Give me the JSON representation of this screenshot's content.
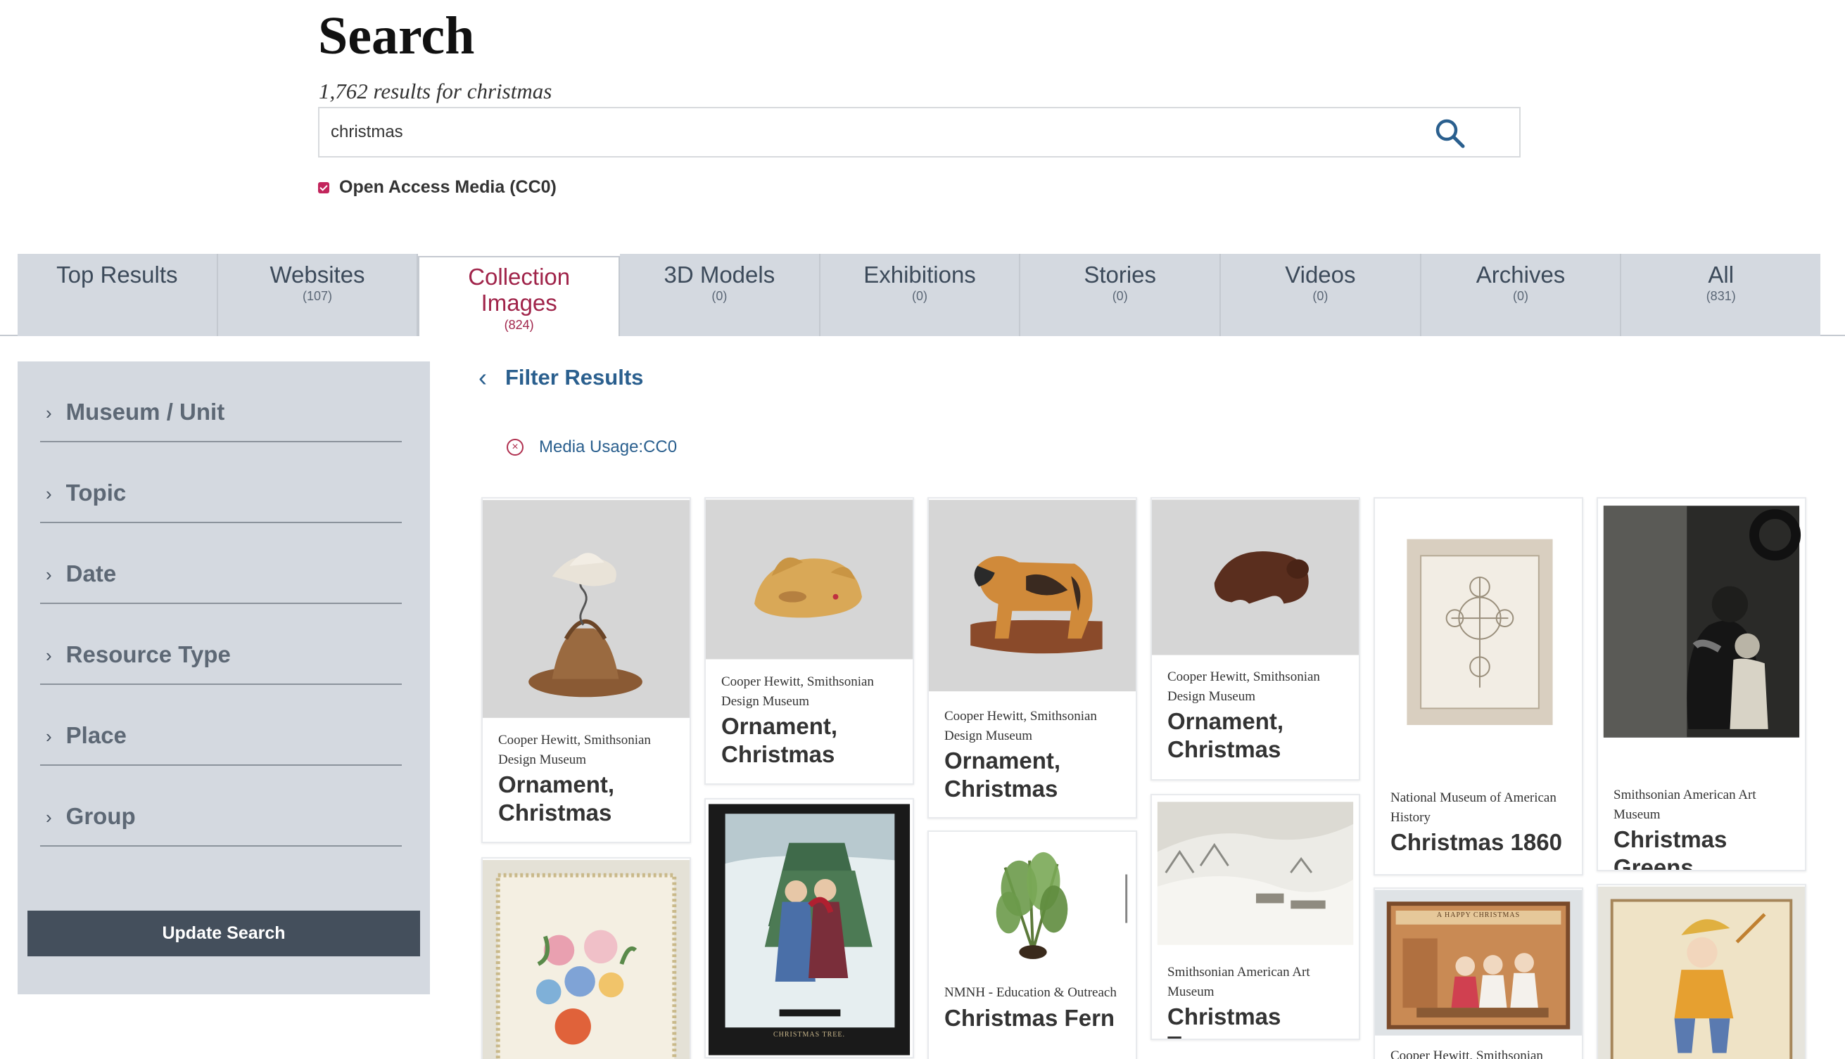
{
  "page": {
    "title": "Search",
    "result_count": "1,762 results for christmas"
  },
  "search": {
    "value": "christmas"
  },
  "open_access": {
    "label": "Open Access Media (CC0)",
    "checked": true
  },
  "tabs": [
    {
      "label": "Top Results",
      "count": ""
    },
    {
      "label": "Websites",
      "count": "(107)"
    },
    {
      "label": "Collection Images",
      "count": "(824)",
      "active": true
    },
    {
      "label": "3D Models",
      "count": "(0)"
    },
    {
      "label": "Exhibitions",
      "count": "(0)"
    },
    {
      "label": "Stories",
      "count": "(0)"
    },
    {
      "label": "Videos",
      "count": "(0)"
    },
    {
      "label": "Archives",
      "count": "(0)"
    },
    {
      "label": "All",
      "count": "(831)"
    }
  ],
  "sidebar": {
    "facets": [
      "Museum / Unit",
      "Topic",
      "Date",
      "Resource Type",
      "Place",
      "Group"
    ],
    "update_label": "Update Search"
  },
  "filters": {
    "title": "Filter Results",
    "active": "Media Usage:CC0"
  },
  "results": [
    {
      "museum": "Cooper Hewitt, Smithsonian Design Museum",
      "title": "Ornament, Christmas"
    },
    {
      "museum": "Cooper Hewitt, Smithsonian Design Museum",
      "title": "Ornament, Christmas"
    },
    {
      "museum": "Cooper Hewitt, Smithsonian Design Museum",
      "title": "Ornament, Christmas"
    },
    {
      "museum": "Cooper Hewitt, Smithsonian Design Museum",
      "title": "Ornament, Christmas"
    },
    {
      "museum": "National Museum of American History",
      "title": "Christmas 1860"
    },
    {
      "museum": "Smithsonian American Art Museum",
      "title": "Christmas Greens"
    },
    {
      "museum": "",
      "title": ""
    },
    {
      "museum": "",
      "title": "",
      "caption": "CHRISTMAS TREE."
    },
    {
      "museum": "NMNH - Education & Outreach",
      "title": "Christmas Fern"
    },
    {
      "museum": "Smithsonian American Art Museum",
      "title": "Christmas Trees"
    },
    {
      "museum": "Cooper Hewitt, Smithsonian",
      "title": "",
      "caption": "A HAPPY CHRISTMAS"
    },
    {
      "museum": "",
      "title": ""
    }
  ],
  "colors": {
    "accent": "#a0244a",
    "link": "#2a5f8e",
    "tab_bg": "#d4d9e0",
    "button_bg": "#444f5c"
  }
}
